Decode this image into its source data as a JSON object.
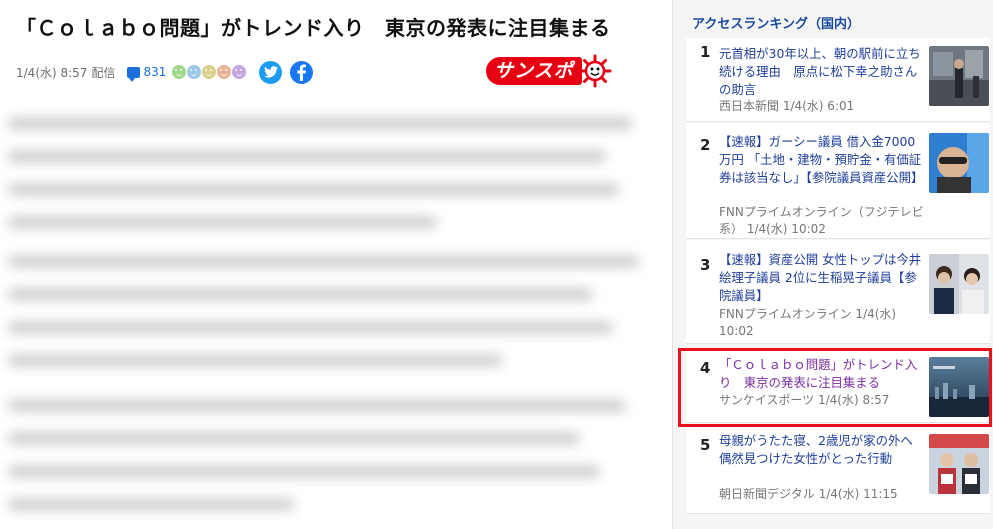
{
  "article": {
    "title": "「Ｃｏｌａｂｏ問題」がトレンド入り　東京の発表に注目集まる",
    "date": "1/4(水) 8:57",
    "delivered": "配信",
    "comment_count": "831",
    "faces": [
      "#9fd88a",
      "#9cc8e8",
      "#d9d08a",
      "#e8b59a",
      "#c6a6e0"
    ],
    "icons": {
      "comment": "comment-bubble-icon",
      "twitter": "twitter-icon",
      "facebook": "facebook-icon"
    },
    "brand": {
      "name": "サンスポ",
      "color": "#e60012"
    }
  },
  "sidebar": {
    "heading": "アクセスランキング（国内）",
    "items": [
      {
        "rank": "1",
        "headline": "元首相が30年以上、朝の駅前に立ち続ける理由　原点に松下幸之助さんの助言",
        "source": "西日本新聞 1/4(水) 6:01"
      },
      {
        "rank": "2",
        "headline": "【速報】ガーシー議員 借入金7000万円 「土地・建物・預貯金・有価証券は該当なし」【参院議員資産公開】",
        "source": "FNNプライムオンライン（フジテレビ系） 1/4(水) 10:02"
      },
      {
        "rank": "3",
        "headline": "【速報】資産公開 女性トップは今井絵理子議員 2位に生稲晃子議員【参院議員】",
        "source": "FNNプライムオンライン 1/4(水) 10:02"
      },
      {
        "rank": "4",
        "headline": "「Ｃｏｌａｂｏ問題」がトレンド入り　東京の発表に注目集まる",
        "source": "サンケイスポーツ 1/4(水) 8:57"
      },
      {
        "rank": "5",
        "headline": "母親がうたた寝、2歳児が家の外へ　偶然見つけた女性がとった行動",
        "source": "朝日新聞デジタル 1/4(水) 11:15"
      }
    ]
  }
}
